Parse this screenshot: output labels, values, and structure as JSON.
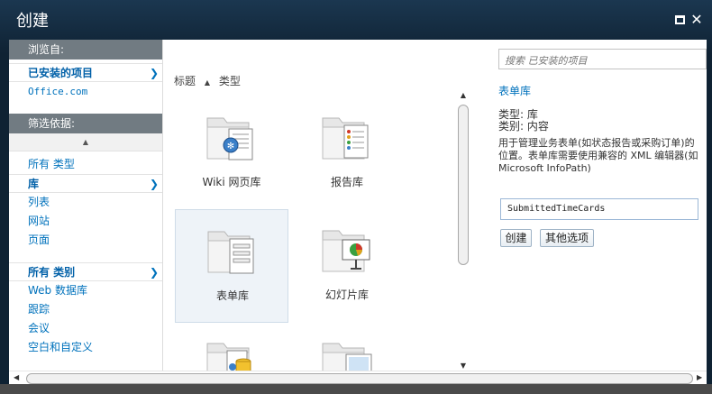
{
  "window": {
    "title": "创建"
  },
  "left_nav": {
    "browse_header": "浏览自:",
    "browse_items": [
      {
        "label": "已安装的项目",
        "selected": true
      },
      {
        "label": "Office.com",
        "selected": false
      }
    ],
    "filter_header": "筛选依据:",
    "type_items": [
      {
        "label": "所有 类型",
        "selected": false
      },
      {
        "label": "库",
        "selected": true
      },
      {
        "label": "列表",
        "selected": false
      },
      {
        "label": "网站",
        "selected": false
      },
      {
        "label": "页面",
        "selected": false
      }
    ],
    "category_items": [
      {
        "label": "所有 类别",
        "selected": true
      },
      {
        "label": "Web 数据库",
        "selected": false
      },
      {
        "label": "跟踪",
        "selected": false
      },
      {
        "label": "会议",
        "selected": false
      },
      {
        "label": "空白和自定义",
        "selected": false
      }
    ]
  },
  "middle": {
    "sort_title": "标题",
    "sort_type": "类型",
    "tiles": [
      {
        "label": "Wiki 网页库",
        "icon": "wiki-library-icon"
      },
      {
        "label": "报告库",
        "icon": "report-library-icon"
      },
      {
        "label": "表单库",
        "icon": "form-library-icon"
      },
      {
        "label": "幻灯片库",
        "icon": "slide-library-icon"
      },
      {
        "label": "",
        "icon": "data-connection-library-icon"
      },
      {
        "label": "",
        "icon": "picture-library-icon"
      }
    ],
    "selected_tile": "表单库"
  },
  "details": {
    "search_placeholder": "搜索 已安装的项目",
    "title": "表单库",
    "type_line": "类型: 库",
    "category_line": "类别: 内容",
    "description": "用于管理业务表单(如状态报告或采购订单)的位置。表单库需要使用兼容的 XML 编辑器(如 Microsoft InfoPath)",
    "name_value": "SubmittedTimeCards",
    "create_label": "创建",
    "more_options_label": "其他选项"
  },
  "colors": {
    "link": "#0072bc",
    "nav_header_bg": "#717b82",
    "frame_bg": "#0f2233"
  }
}
